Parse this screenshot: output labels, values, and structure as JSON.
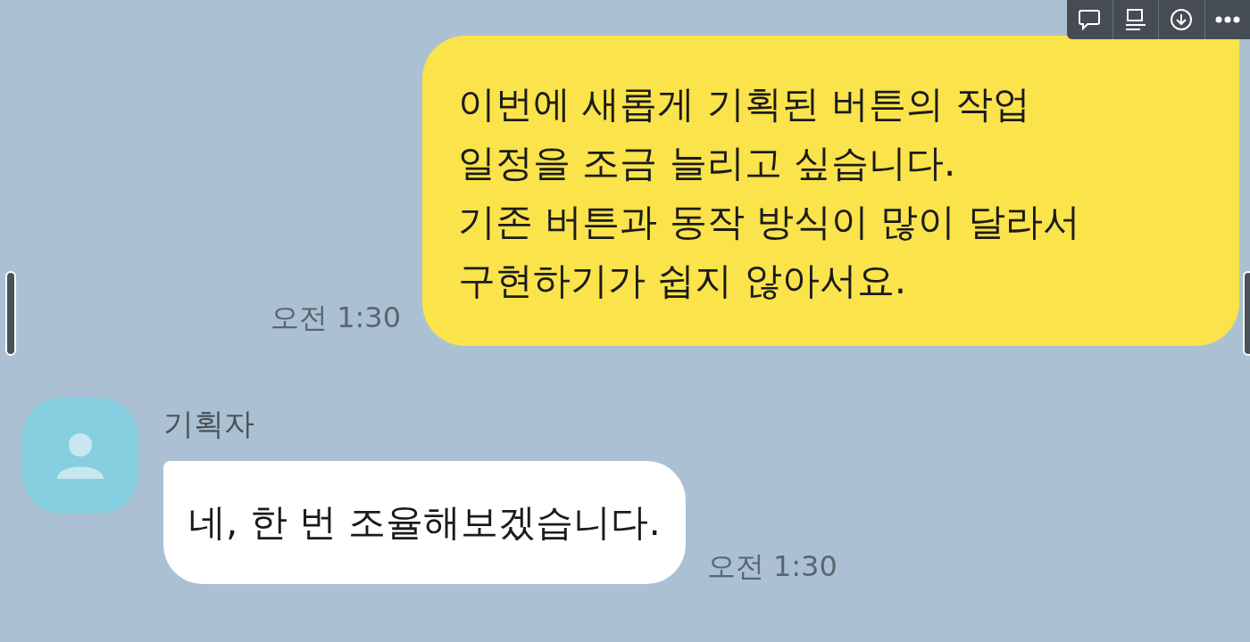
{
  "messages": [
    {
      "kind": "outgoing",
      "lines": [
        "이번에 새롭게 기획된 버튼의 작업",
        "일정을 조금 늘리고 싶습니다.",
        "기존 버튼과 동작 방식이 많이 달라서",
        "구현하기가 쉽지 않아서요."
      ],
      "time": "오전 1:30"
    },
    {
      "kind": "incoming",
      "sender": "기획자",
      "lines": [
        "네, 한 번 조율해보겠습니다."
      ],
      "time": "오전 1:30"
    }
  ]
}
